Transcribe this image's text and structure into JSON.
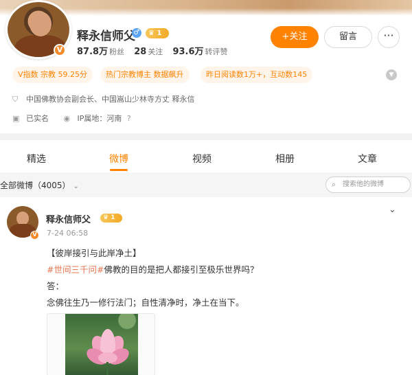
{
  "profile": {
    "name": "释永信师父",
    "vip_level": "1",
    "verified_badge": "V",
    "stats": [
      {
        "value": "87.8万",
        "label": "粉丝"
      },
      {
        "value": "28",
        "label": "关注"
      },
      {
        "value": "93.6万",
        "label": "转评赞"
      }
    ],
    "follow_label": "+关注",
    "message_label": "留言",
    "more_label": "···",
    "tags": [
      "V指数 宗教 59.25分",
      "热门宗教博主 数据飙升",
      "昨日阅读数1万+，互动数145"
    ],
    "description": "中国佛教协会副会长、中国嵩山少林寺方丈 释永信",
    "real_name_status": "已实名",
    "ip_location": "IP属地：河南"
  },
  "tabs": [
    {
      "label": "精选",
      "active": false
    },
    {
      "label": "微博",
      "active": true
    },
    {
      "label": "视频",
      "active": false
    },
    {
      "label": "相册",
      "active": false
    },
    {
      "label": "文章",
      "active": false
    }
  ],
  "feed": {
    "title": "全部微博（4005）",
    "search_placeholder": "搜索他的微博"
  },
  "post": {
    "author": "释永信师父",
    "vip_level": "1",
    "time": "7-24 06:58",
    "title": "【彼岸接引与此岸净土】",
    "hashtag": "#世间三千问#",
    "question": "佛教的目的是把人都接引至极乐世界吗？",
    "answer_label": "答：",
    "answer": "念佛往生乃一修行法门；自性清净时，净土在当下。"
  },
  "colors": {
    "accent": "#ff8200",
    "hashtag": "#eb7350",
    "chip_bg": "#fff4ea"
  }
}
